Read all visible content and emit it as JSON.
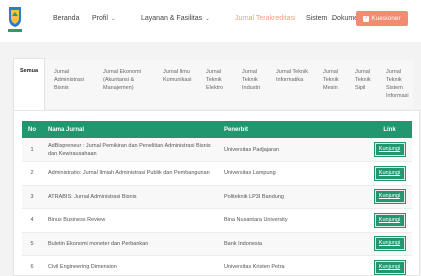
{
  "nav": {
    "items": [
      {
        "label": "Beranda",
        "dropdown": false,
        "active": false
      },
      {
        "label": "Profil",
        "dropdown": true,
        "active": false
      },
      {
        "label": "Layanan & Fasilitas",
        "dropdown": true,
        "active": false
      },
      {
        "label": "Jurnal Terakreditasi",
        "dropdown": false,
        "active": true
      },
      {
        "label": "Sistem",
        "dropdown": true,
        "active": false
      },
      {
        "label": "Dokumen",
        "dropdown": false,
        "active": false
      }
    ],
    "kuesioner_label": "Kuesioner",
    "active_color": "#f0a07a",
    "button_color": "#f28b6f"
  },
  "tabs": [
    "Semua",
    "Jurnal Administrasi Bisnis",
    "Jurnal Ekonomi (Akuntansi & Manajemen)",
    "Jurnal Ilmu Komunikasi",
    "Jurnal Teknik Elektro",
    "Jurnal Teknik Industri",
    "Jurnal Teknik Informatika",
    "Jurnal Teknik Mesin",
    "Jurnal Teknik Sipil",
    "Jurnal Teknik Sistem Informasi"
  ],
  "table": {
    "header_color": "#21966f",
    "columns": [
      "No",
      "Nama Jurnal",
      "Penerbit",
      "Link"
    ],
    "rows": [
      {
        "no": "1",
        "nama": "AdBispreneur : Jurnal Pemikiran dan Penelitian Administrasi Bisnis dan Kewirausahaan",
        "penerbit": "Universitas Padjajaran",
        "link": "Kunjungi"
      },
      {
        "no": "2",
        "nama": "Administratio: Jurnal Ilmiah Administrasi Publik dan Pembangunan",
        "penerbit": "Universitas Lampung",
        "link": "Kunjungi"
      },
      {
        "no": "3",
        "nama": "ATRABIS: Jurnal Administrasi Bisnis",
        "penerbit": "Politeknik LP3I Bandung",
        "link": "Kunjungi"
      },
      {
        "no": "4",
        "nama": "Binus Business Review",
        "penerbit": "Bina Nusantara University",
        "link": "Kunjungi"
      },
      {
        "no": "5",
        "nama": "Buletin Ekonomi moneter dan Perbankan",
        "penerbit": "Bank Indonesia",
        "link": "Kunjungi"
      },
      {
        "no": "6",
        "nama": "Civil Engineering Dimension",
        "penerbit": "Universitas Kristen Petra",
        "link": "Kunjungi"
      }
    ]
  }
}
